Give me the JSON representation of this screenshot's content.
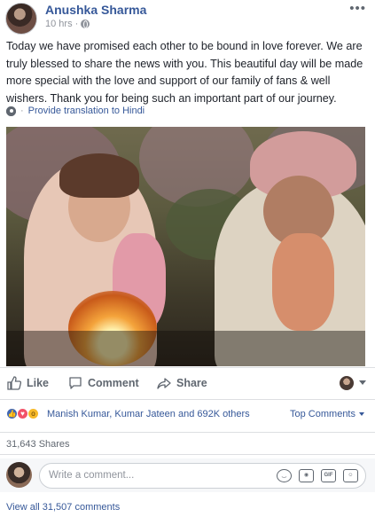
{
  "post": {
    "author": "Anushka Sharma",
    "time": "10 hrs",
    "more_icon": "ellipsis-icon",
    "text": "Today we have promised each other to be bound in love forever. We are truly blessed to share the news with you. This beautiful day will be made more special with the love and support of our family of fans & well wishers. Thank you for being such an important part of our journey.",
    "translate_link": "Provide translation to Hindi",
    "translate_separator": "·"
  },
  "actions": {
    "like": "Like",
    "comment": "Comment",
    "share": "Share"
  },
  "reactions": {
    "types": [
      "like",
      "love",
      "wow"
    ],
    "summary": "Manish Kumar, Kumar Jateen and 692K others",
    "top_comments": "Top Comments"
  },
  "shares": "31,643 Shares",
  "comment_box": {
    "placeholder": "Write a comment..."
  },
  "view_all": "View all 31,507 comments",
  "colors": {
    "link": "#365899",
    "muted": "#90949c",
    "like_blue": "#4267b2",
    "love_red": "#f25268",
    "wow_yellow": "#f7b928"
  }
}
